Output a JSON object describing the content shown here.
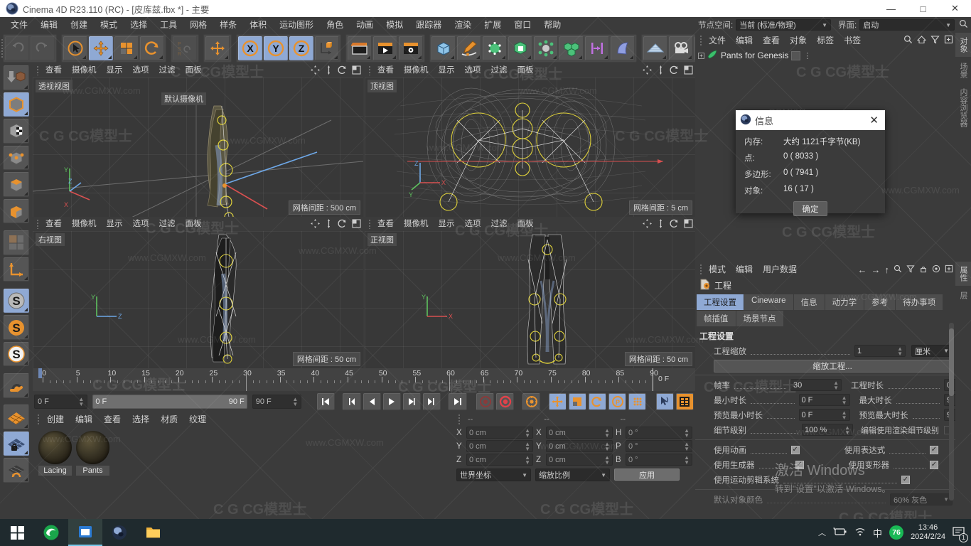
{
  "titlebar": {
    "title": "Cinema 4D R23.110 (RC) - [皮库兹.fbx *] - 主要",
    "minimize": "―",
    "maximize": "□",
    "close": "✕"
  },
  "menubar": {
    "items": [
      "文件",
      "编辑",
      "创建",
      "模式",
      "选择",
      "工具",
      "网格",
      "样条",
      "体积",
      "运动图形",
      "角色",
      "动画",
      "模拟",
      "跟踪器",
      "渲染",
      "扩展",
      "窗口",
      "帮助"
    ]
  },
  "nodespace": {
    "label": "节点空间:",
    "value": "当前 (标准/物理)",
    "interface_label": "界面:",
    "interface_value": "启动"
  },
  "viewports": [
    {
      "name": "透视视图",
      "menu": [
        "查看",
        "摄像机",
        "显示",
        "选项",
        "过滤",
        "面板"
      ],
      "grid": "网格间距 : 500 cm",
      "camera": "默认摄像机"
    },
    {
      "name": "顶视图",
      "menu": [
        "查看",
        "摄像机",
        "显示",
        "选项",
        "过滤",
        "面板"
      ],
      "grid": "网格间距 : 5 cm",
      "camera": ""
    },
    {
      "name": "右视图",
      "menu": [
        "查看",
        "摄像机",
        "显示",
        "选项",
        "过滤",
        "面板"
      ],
      "grid": "网格间距 : 50 cm",
      "camera": ""
    },
    {
      "name": "正视图",
      "menu": [
        "查看",
        "摄像机",
        "显示",
        "选项",
        "过滤",
        "面板"
      ],
      "grid": "网格间距 : 50 cm",
      "camera": ""
    }
  ],
  "timeline": {
    "ticks": [
      0,
      5,
      10,
      15,
      20,
      25,
      30,
      35,
      40,
      45,
      50,
      55,
      60,
      65,
      70,
      75,
      80,
      85,
      90
    ],
    "end_label": "0 F",
    "current_frame": "0 F",
    "range_start": "0 F",
    "range_end": "90 F",
    "max_frame": "90 F"
  },
  "materials": {
    "menu": [
      "创建",
      "编辑",
      "查看",
      "选择",
      "材质",
      "纹理"
    ],
    "items": [
      {
        "name": "Lacing"
      },
      {
        "name": "Pants"
      }
    ]
  },
  "coordinates": {
    "header_dashes": [
      "--",
      "--",
      "--"
    ],
    "rows": [
      {
        "ax1": "X",
        "v1": "0 cm",
        "ax2": "X",
        "v2": "0 cm",
        "ax3": "H",
        "v3": "0 °"
      },
      {
        "ax1": "Y",
        "v1": "0 cm",
        "ax2": "Y",
        "v2": "0 cm",
        "ax3": "P",
        "v3": "0 °"
      },
      {
        "ax1": "Z",
        "v1": "0 cm",
        "ax2": "Z",
        "v2": "0 cm",
        "ax3": "B",
        "v3": "0 °"
      }
    ],
    "world_select": "世界坐标",
    "scale_select": "缩放比例",
    "apply": "应用"
  },
  "object_manager": {
    "menu": [
      "文件",
      "编辑",
      "查看",
      "对象",
      "标签",
      "书签"
    ],
    "objects": [
      {
        "name": "Pants for Genesis"
      }
    ],
    "vtabs": [
      "对象",
      "场景",
      "内容浏览器"
    ]
  },
  "attribute_manager": {
    "menu": [
      "模式",
      "编辑",
      "用户数据"
    ],
    "title": "工程",
    "tabs_row1": [
      "工程设置",
      "Cineware",
      "信息",
      "动力学",
      "参考",
      "待办事项"
    ],
    "tabs_row2": [
      "帧插值",
      "场景节点"
    ],
    "active_tab": "工程设置",
    "section": "工程设置",
    "scale_label": "工程缩放",
    "scale_value": "1",
    "unit_value": "厘米",
    "scale_button": "缩放工程...",
    "fields": [
      {
        "label": "帧率",
        "value": "30",
        "label2": "工程时长",
        "value2": "0"
      },
      {
        "label": "最小时长",
        "value": "0 F",
        "label2": "最大时长",
        "value2": "9"
      },
      {
        "label": "预览最小时长",
        "value": "0 F",
        "label2": "预览最大时长",
        "value2": "9"
      }
    ],
    "lod_label": "细节级别",
    "lod_value": "100 %",
    "lod_label2": "编辑使用渲染细节级别",
    "checks": [
      {
        "label": "使用动画",
        "checked": true,
        "label2": "使用表达式",
        "checked2": true
      },
      {
        "label": "使用生成器",
        "checked": true,
        "label2": "使用变形器",
        "checked2": true
      },
      {
        "label": "使用运动剪辑系统",
        "checked": true,
        "label2": "",
        "checked2": null
      }
    ],
    "last_label": "默认对象颜色",
    "last_value": "60% 灰色",
    "vtabs": [
      "属性",
      "层"
    ]
  },
  "info_dialog": {
    "title": "信息",
    "rows": [
      {
        "key": "内存:",
        "value": "大约 1121千字节(KB)"
      },
      {
        "key": "点:",
        "value": "0 ( 8033 )"
      },
      {
        "key": "多边形:",
        "value": "0 ( 7941 )"
      },
      {
        "key": "对象:",
        "value": "16 ( 17 )"
      }
    ],
    "ok": "确定",
    "close": "✕"
  },
  "activate_windows": {
    "line1": "激活 Windows",
    "line2": "转到\"设置\"以激活 Windows。"
  },
  "taskbar": {
    "time": "13:46",
    "date": "2024/2/24",
    "ime": "中",
    "battery_badge": "76",
    "notification_count": "1"
  },
  "watermarks": {
    "site": "www.CGMXW.com",
    "logo": "CG模型士"
  },
  "colors": {
    "accent_blue": "#8fa9d4",
    "orange": "#e8922e",
    "panel": "#3b3b3b",
    "viewport": "#383838",
    "taskbar": "#1f2a2e"
  }
}
